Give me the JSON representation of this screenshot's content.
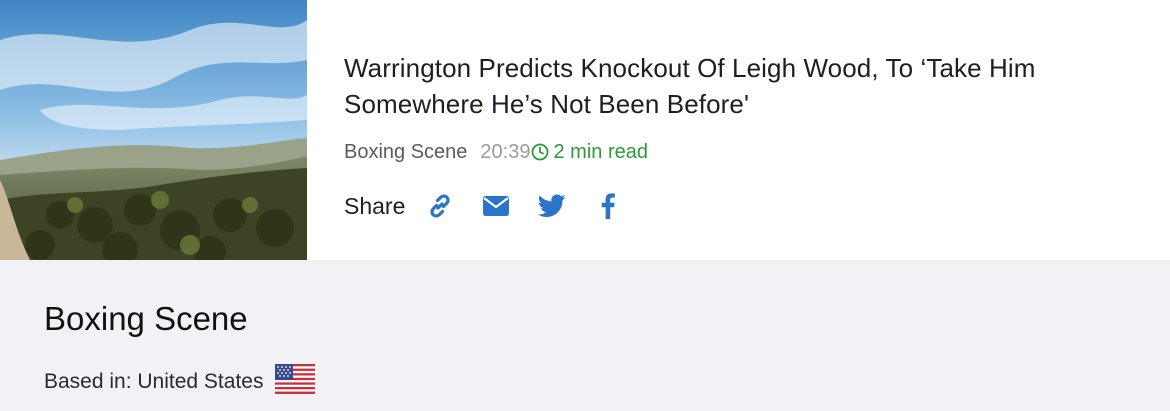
{
  "article": {
    "headline": "Warrington Predicts Knockout Of Leigh Wood, To ‘Take Him Somewhere He’s Not Been Before'",
    "source": "Boxing Scene",
    "time": "20:39",
    "read_time": "2 min read",
    "share_label": "Share",
    "share_icons": [
      "link-icon",
      "email-icon",
      "twitter-icon",
      "facebook-icon"
    ],
    "thumbnail_icon": "landscape-thumbnail"
  },
  "source_panel": {
    "name": "Boxing Scene",
    "based_in": "Based in: United States",
    "flag_icon": "us-flag-icon"
  },
  "colors": {
    "accent_blue": "#2a74c9",
    "read_green": "#2a9a3a",
    "panel_bg": "#f2f1f6"
  }
}
